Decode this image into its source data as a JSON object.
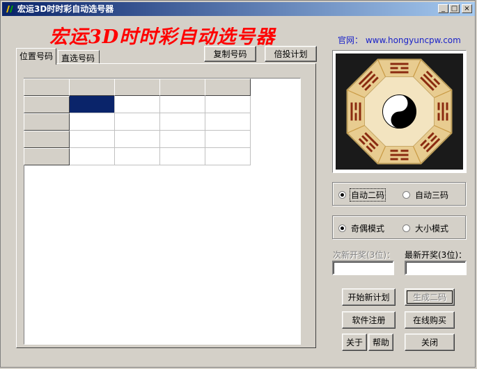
{
  "window": {
    "title": "宏运3D时时彩自动选号器",
    "minimize_glyph": "_",
    "maximize_glyph": "□",
    "close_glyph": "×"
  },
  "banner": {
    "text": "宏运3D时时彩自动选号器",
    "color": "#ff0000"
  },
  "website": {
    "text": "官网： www.hongyuncpw.com",
    "color": "#1a22c8"
  },
  "tabs": [
    {
      "label": "位置号码",
      "active": true
    },
    {
      "label": "直选号码",
      "active": false
    }
  ],
  "toolbar": {
    "copy_label": "复制号码",
    "multiplier_label": "倍投计划"
  },
  "grid": {
    "header_row": [
      "",
      "",
      "",
      "",
      ""
    ],
    "row_headers": [
      "",
      "",
      "",
      ""
    ],
    "rows": [
      [
        "",
        "",
        "",
        ""
      ],
      [
        "",
        "",
        "",
        ""
      ],
      [
        "",
        "",
        "",
        ""
      ],
      [
        "",
        "",
        "",
        ""
      ]
    ],
    "selected_color": "#0a246a"
  },
  "image": {
    "icon": "bagua-yinyang-icon"
  },
  "code_mode": {
    "options": [
      {
        "label": "自动二码",
        "checked": true
      },
      {
        "label": "自动三码",
        "checked": false
      }
    ]
  },
  "pattern_mode": {
    "options": [
      {
        "label": "奇偶模式",
        "checked": true
      },
      {
        "label": "大小模式",
        "checked": false
      }
    ]
  },
  "draws": {
    "previous_label": "次新开奖(3位)：",
    "previous_value": "",
    "latest_label": "最新开奖(3位)：",
    "latest_value": ""
  },
  "actions": {
    "start_plan": "开始新计划",
    "generate_two": "生成二码",
    "register": "软件注册",
    "buy_online": "在线购买",
    "about": "关于",
    "help": "帮助",
    "close": "关闭"
  }
}
